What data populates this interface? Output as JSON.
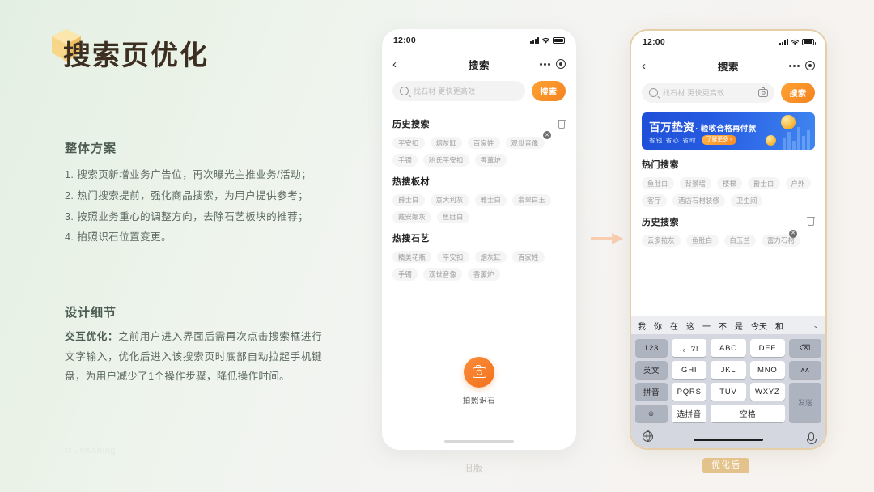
{
  "slide": {
    "title": "搜索页优化",
    "watermark": "© Jowshing",
    "sections": {
      "overall_heading": "整体方案",
      "overall_items": [
        "1. 搜索页新增业务广告位，再次曝光主推业务/活动；",
        "2. 热门搜索提前，强化商品搜索，为用户提供参考；",
        "3. 按照业务重心的调整方向，去除石艺板块的推荐；",
        "4. 拍照识石位置变更。"
      ],
      "detail_heading": "设计细节",
      "detail_label": "交互优化：",
      "detail_text": "之前用户进入界面后需再次点击搜索框进行文字输入，优化后进入该搜索页时底部自动拉起手机键盘，为用户减少了1个操作步骤，降低操作时间。"
    },
    "captions": {
      "old": "旧版",
      "new": "优化后"
    },
    "arrow_color": "#f6c7a8",
    "accent_orange": "#f4821f",
    "accent_gold": "#e3c28c"
  },
  "status_bar": {
    "time": "12:00"
  },
  "nav": {
    "back_glyph": "‹",
    "title": "搜索"
  },
  "search": {
    "placeholder": "找石材 更快更高效",
    "button_label": "搜索"
  },
  "phone_old": {
    "sections": [
      {
        "title": "历史搜索",
        "has_trash": true,
        "has_delete_badge": true,
        "tags": [
          "平安扣",
          "烟灰缸",
          "百家姓",
          "观世音像",
          "手镯",
          "胎氏平安扣",
          "香薰炉"
        ]
      },
      {
        "title": "热搜板材",
        "has_trash": false,
        "has_delete_badge": false,
        "tags": [
          "爵士白",
          "意大利灰",
          "雅士白",
          "翡翠白玉",
          "戴安娜灰",
          "鱼肚白"
        ]
      },
      {
        "title": "热搜石艺",
        "has_trash": false,
        "has_delete_badge": false,
        "tags": [
          "精美花瓶",
          "平安扣",
          "烟灰缸",
          "百家姓",
          "手镯",
          "观世音像",
          "香薰炉"
        ]
      }
    ],
    "camera": {
      "label": "拍照识石"
    }
  },
  "phone_new": {
    "banner": {
      "headline": "百万垫资",
      "sub": "· 验收合格再付款",
      "tagline": "省钱 省心 省时",
      "cta": "了解更多",
      "cta_arrow": "›"
    },
    "sections": [
      {
        "title": "热门搜索",
        "has_trash": false,
        "has_delete_badge": false,
        "tags": [
          "鱼肚白",
          "背景墙",
          "楼梯",
          "爵士白",
          "户外",
          "客厅",
          "酒店石材装修",
          "卫生间"
        ]
      },
      {
        "title": "历史搜索",
        "has_trash": true,
        "has_delete_badge": true,
        "tags": [
          "云多拉灰",
          "鱼肚白",
          "白玉兰",
          "富力石材"
        ]
      }
    ],
    "keyboard": {
      "suggestions": [
        "我",
        "你",
        "在",
        "这",
        "一",
        "不",
        "是",
        "今天",
        "和"
      ],
      "suggestion_chevron": "⌄",
      "rows": [
        [
          "123",
          ",。?!",
          "ABC",
          "DEF",
          "⌫"
        ],
        [
          "英文",
          "GHI",
          "JKL",
          "MNO",
          "ᴀᴀ"
        ],
        [
          "拼音",
          "PQRS",
          "TUV",
          "WXYZ",
          "发送"
        ],
        [
          "☺",
          "选拼音",
          "空格"
        ]
      ]
    }
  }
}
